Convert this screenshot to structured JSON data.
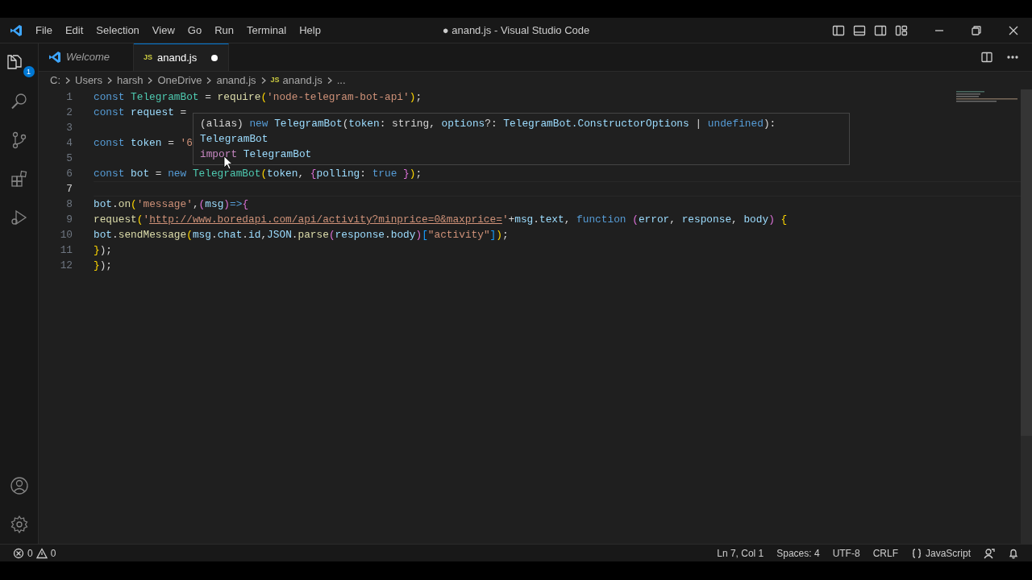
{
  "window": {
    "title": "● anand.js - Visual Studio Code"
  },
  "menu": [
    "File",
    "Edit",
    "Selection",
    "View",
    "Go",
    "Run",
    "Terminal",
    "Help"
  ],
  "activity_bar": [
    {
      "kind": "files",
      "badge": "1",
      "selected": true
    },
    {
      "kind": "search",
      "selected": false
    },
    {
      "kind": "source-control",
      "selected": false
    },
    {
      "kind": "extensions",
      "selected": false
    },
    {
      "kind": "run-debug",
      "selected": false
    }
  ],
  "activity_bottom": [
    {
      "kind": "account"
    },
    {
      "kind": "settings"
    }
  ],
  "tabs": [
    {
      "label": "Welcome",
      "kind": "welcome",
      "selected": false,
      "dirty": false
    },
    {
      "label": "anand.js",
      "kind": "js",
      "icon_text": "JS",
      "selected": true,
      "dirty": true
    }
  ],
  "breadcrumb": [
    {
      "label": "C:",
      "kind": "folder"
    },
    {
      "label": "Users",
      "kind": "folder"
    },
    {
      "label": "harsh",
      "kind": "folder"
    },
    {
      "label": "OneDrive",
      "kind": "folder"
    },
    {
      "label": "anand.js",
      "kind": "folder"
    },
    {
      "label": "anand.js",
      "kind": "js",
      "icon_text": "JS"
    },
    {
      "label": "...",
      "kind": "folder"
    }
  ],
  "editor": {
    "lines": [
      {
        "number": "1",
        "tokens": [
          {
            "text": "const ",
            "kind": "keyword"
          },
          {
            "text": "TelegramBot",
            "kind": "class"
          },
          {
            "text": " = ",
            "kind": "plain"
          },
          {
            "text": "require",
            "kind": "func"
          },
          {
            "text": "(",
            "kind": "bracket1"
          },
          {
            "text": "'node-telegram-bot-api'",
            "kind": "string"
          },
          {
            "text": ")",
            "kind": "bracket1"
          },
          {
            "text": ";",
            "kind": "plain"
          }
        ]
      },
      {
        "number": "2",
        "tokens": [
          {
            "text": "const ",
            "kind": "keyword"
          },
          {
            "text": "request",
            "kind": "var"
          },
          {
            "text": " = ",
            "kind": "plain"
          }
        ]
      },
      {
        "number": "3"
      },
      {
        "number": "4",
        "tokens": [
          {
            "text": "const ",
            "kind": "keyword"
          },
          {
            "text": "token",
            "kind": "var"
          },
          {
            "text": " = ",
            "kind": "plain"
          },
          {
            "text": "'6",
            "kind": "string"
          }
        ]
      },
      {
        "number": "5"
      },
      {
        "number": "6",
        "tokens": [
          {
            "text": "const ",
            "kind": "keyword"
          },
          {
            "text": "bot",
            "kind": "var"
          },
          {
            "text": " = ",
            "kind": "plain"
          },
          {
            "text": "new ",
            "kind": "keyword"
          },
          {
            "text": "TelegramBot",
            "kind": "class"
          },
          {
            "text": "(",
            "kind": "bracket1"
          },
          {
            "text": "token",
            "kind": "var"
          },
          {
            "text": ", ",
            "kind": "plain"
          },
          {
            "text": "{",
            "kind": "bracket2"
          },
          {
            "text": "polling",
            "kind": "var"
          },
          {
            "text": ": ",
            "kind": "plain"
          },
          {
            "text": "true",
            "kind": "keyword"
          },
          {
            "text": " }",
            "kind": "bracket2"
          },
          {
            "text": ")",
            "kind": "bracket1"
          },
          {
            "text": ";",
            "kind": "plain"
          }
        ]
      },
      {
        "number": "7",
        "current": true
      },
      {
        "number": "8",
        "tokens": [
          {
            "text": "bot",
            "kind": "var"
          },
          {
            "text": ".",
            "kind": "plain"
          },
          {
            "text": "on",
            "kind": "func"
          },
          {
            "text": "(",
            "kind": "bracket1"
          },
          {
            "text": "'message'",
            "kind": "string"
          },
          {
            "text": ",",
            "kind": "plain"
          },
          {
            "text": "(",
            "kind": "bracket2"
          },
          {
            "text": "msg",
            "kind": "var"
          },
          {
            "text": ")",
            "kind": "bracket2"
          },
          {
            "text": "=>",
            "kind": "keyword"
          },
          {
            "text": "{",
            "kind": "bracket2"
          }
        ]
      },
      {
        "number": "9",
        "tokens": [
          {
            "text": "request",
            "kind": "func"
          },
          {
            "text": "(",
            "kind": "bracket1"
          },
          {
            "text": "'",
            "kind": "string"
          },
          {
            "text": "http://www.boredapi.com/api/activity?minprice=0&maxprice=",
            "kind": "link"
          },
          {
            "text": "'",
            "kind": "string"
          },
          {
            "text": "+",
            "kind": "plain"
          },
          {
            "text": "msg",
            "kind": "var"
          },
          {
            "text": ".",
            "kind": "plain"
          },
          {
            "text": "text",
            "kind": "var"
          },
          {
            "text": ", ",
            "kind": "plain"
          },
          {
            "text": "function ",
            "kind": "keyword"
          },
          {
            "text": "(",
            "kind": "bracket2"
          },
          {
            "text": "error",
            "kind": "var"
          },
          {
            "text": ", ",
            "kind": "plain"
          },
          {
            "text": "response",
            "kind": "var"
          },
          {
            "text": ", ",
            "kind": "plain"
          },
          {
            "text": "body",
            "kind": "var"
          },
          {
            "text": ") ",
            "kind": "bracket2"
          },
          {
            "text": "{",
            "kind": "bracket1"
          }
        ]
      },
      {
        "number": "10",
        "tokens": [
          {
            "text": "bot",
            "kind": "var"
          },
          {
            "text": ".",
            "kind": "plain"
          },
          {
            "text": "sendMessage",
            "kind": "func"
          },
          {
            "text": "(",
            "kind": "bracket1"
          },
          {
            "text": "msg",
            "kind": "var"
          },
          {
            "text": ".",
            "kind": "plain"
          },
          {
            "text": "chat",
            "kind": "var"
          },
          {
            "text": ".",
            "kind": "plain"
          },
          {
            "text": "id",
            "kind": "var"
          },
          {
            "text": ",",
            "kind": "plain"
          },
          {
            "text": "JSON",
            "kind": "var"
          },
          {
            "text": ".",
            "kind": "plain"
          },
          {
            "text": "parse",
            "kind": "func"
          },
          {
            "text": "(",
            "kind": "bracket2"
          },
          {
            "text": "response",
            "kind": "var"
          },
          {
            "text": ".",
            "kind": "plain"
          },
          {
            "text": "body",
            "kind": "var"
          },
          {
            "text": ")",
            "kind": "bracket2"
          },
          {
            "text": "[",
            "kind": "bracket3"
          },
          {
            "text": "\"activity\"",
            "kind": "string"
          },
          {
            "text": "]",
            "kind": "bracket3"
          },
          {
            "text": ")",
            "kind": "bracket1"
          },
          {
            "text": ";",
            "kind": "plain"
          }
        ]
      },
      {
        "number": "11",
        "tokens": [
          {
            "text": "}",
            "kind": "bracket1"
          },
          {
            "text": ");",
            "kind": "plain"
          }
        ]
      },
      {
        "number": "12",
        "tokens": [
          {
            "text": "}",
            "kind": "bracket1"
          },
          {
            "text": ");",
            "kind": "plain"
          }
        ]
      }
    ]
  },
  "hover": {
    "lines": [
      [
        {
          "text": "(alias) ",
          "kind": "plain"
        },
        {
          "text": "new ",
          "kind": "keyword"
        },
        {
          "text": "TelegramBot",
          "kind": "var"
        },
        {
          "text": "(",
          "kind": "plain"
        },
        {
          "text": "token",
          "kind": "var"
        },
        {
          "text": ": string, ",
          "kind": "plain"
        },
        {
          "text": "options",
          "kind": "var"
        },
        {
          "text": "?: ",
          "kind": "plain"
        },
        {
          "text": "TelegramBot.ConstructorOptions",
          "kind": "var"
        },
        {
          "text": " | ",
          "kind": "plain"
        },
        {
          "text": "undefined",
          "kind": "keyword"
        },
        {
          "text": "):",
          "kind": "plain"
        }
      ],
      [
        {
          "text": "TelegramBot",
          "kind": "var"
        }
      ],
      [
        {
          "text": "import ",
          "kind": "import"
        },
        {
          "text": "TelegramBot",
          "kind": "var"
        }
      ]
    ]
  },
  "status_bar": {
    "errors": "0",
    "warnings": "0",
    "items": [
      "Ln 7, Col 1",
      "Spaces: 4",
      "UTF-8",
      "CRLF"
    ],
    "language": "JavaScript"
  }
}
